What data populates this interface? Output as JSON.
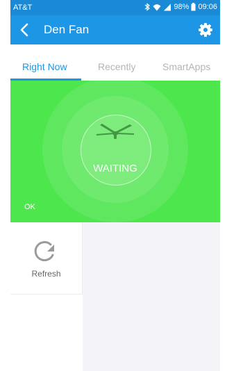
{
  "status_bar": {
    "carrier": "AT&T",
    "battery": "98%",
    "time": "09:06"
  },
  "app_bar": {
    "title": "Den Fan"
  },
  "tabs": [
    {
      "label": "Right Now",
      "active": true
    },
    {
      "label": "Recently",
      "active": false
    },
    {
      "label": "SmartApps",
      "active": false
    }
  ],
  "main_tile": {
    "status": "WAITING",
    "sub_status": "OK",
    "color": "#4de64d"
  },
  "tiles": [
    {
      "label": "Refresh",
      "icon": "refresh-icon"
    }
  ],
  "colors": {
    "accent": "#1e96e6",
    "status_bar": "#1b8ad6"
  }
}
